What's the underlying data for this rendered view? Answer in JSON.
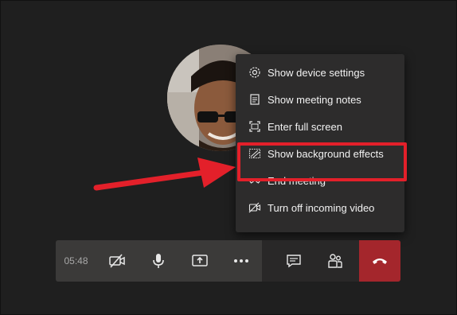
{
  "menu": {
    "items": [
      {
        "label": "Show device settings",
        "icon": "gear-icon"
      },
      {
        "label": "Show meeting notes",
        "icon": "notes-icon"
      },
      {
        "label": "Enter full screen",
        "icon": "fullscreen-icon"
      },
      {
        "label": "Show background effects",
        "icon": "background-effects-icon"
      },
      {
        "label": "End meeting",
        "icon": "end-meeting-icon"
      },
      {
        "label": "Turn off incoming video",
        "icon": "video-off-icon"
      }
    ],
    "highlighted_index": 3
  },
  "toolbar": {
    "timer": "05:48",
    "buttons": [
      "camera-off-icon",
      "microphone-icon",
      "share-screen-icon",
      "more-options-icon",
      "chat-icon",
      "participants-icon",
      "hang-up-icon"
    ]
  },
  "colors": {
    "background": "#1f1f1f",
    "menu_bg": "#2d2c2c",
    "highlight": "#e3202a",
    "hangup": "#a4262c"
  }
}
